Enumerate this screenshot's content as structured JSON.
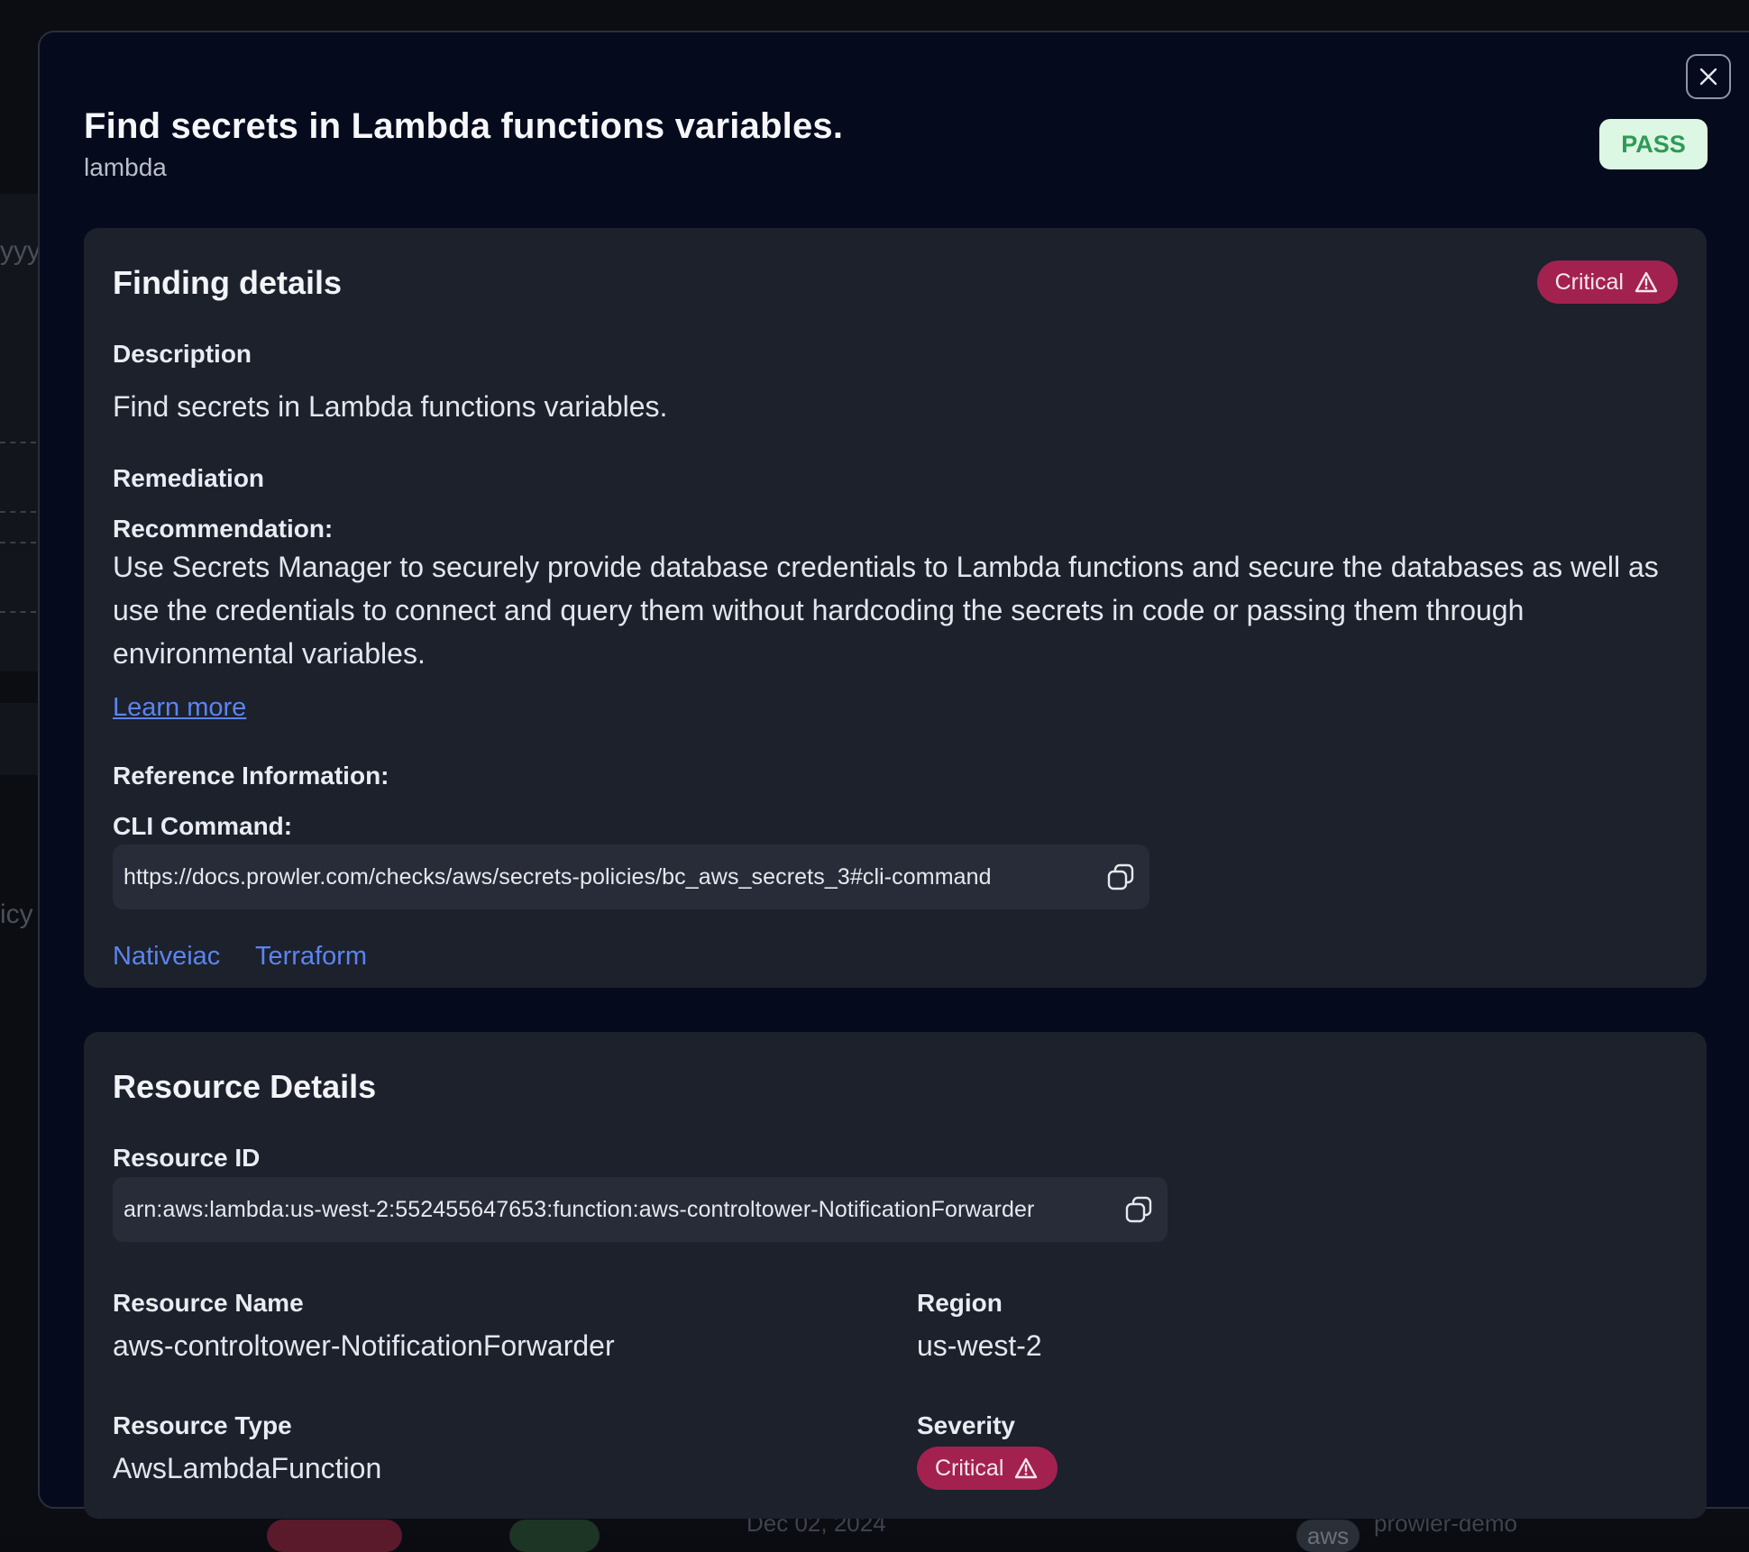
{
  "background": {
    "fragments": [
      "yyy",
      "icy"
    ],
    "bottom_date": "Dec 02, 2024",
    "bottom_provider": "aws",
    "bottom_account": "prowler-demo"
  },
  "modal": {
    "title": "Find secrets in Lambda functions variables.",
    "subtitle": "lambda",
    "status": "PASS",
    "close_icon": "close-icon"
  },
  "finding": {
    "heading": "Finding details",
    "severity": "Critical",
    "description_label": "Description",
    "description": "Find secrets in Lambda functions variables.",
    "remediation_label": "Remediation",
    "recommendation_label": "Recommendation:",
    "recommendation": "Use Secrets Manager to securely provide database credentials to Lambda functions and secure the databases as well as use the credentials to connect and query them without hardcoding the secrets in code or passing them through environmental variables.",
    "learn_more": "Learn more",
    "reference_label": "Reference Information:",
    "cli_label": "CLI Command:",
    "cli_command": "https://docs.prowler.com/checks/aws/secrets-policies/bc_aws_secrets_3#cli-command",
    "links": [
      "Nativeiac",
      "Terraform"
    ]
  },
  "resource": {
    "heading": "Resource Details",
    "id_label": "Resource ID",
    "id": "arn:aws:lambda:us-west-2:552455647653:function:aws-controltower-NotificationForwarder",
    "name_label": "Resource Name",
    "name": "aws-controltower-NotificationForwarder",
    "region_label": "Region",
    "region": "us-west-2",
    "type_label": "Resource Type",
    "type": "AwsLambdaFunction",
    "severity_label": "Severity",
    "severity": "Critical"
  },
  "colors": {
    "critical": "#a3214f",
    "pass_bg": "#dcf7e4",
    "pass_text": "#2f9a55",
    "link": "#5b84f0"
  }
}
